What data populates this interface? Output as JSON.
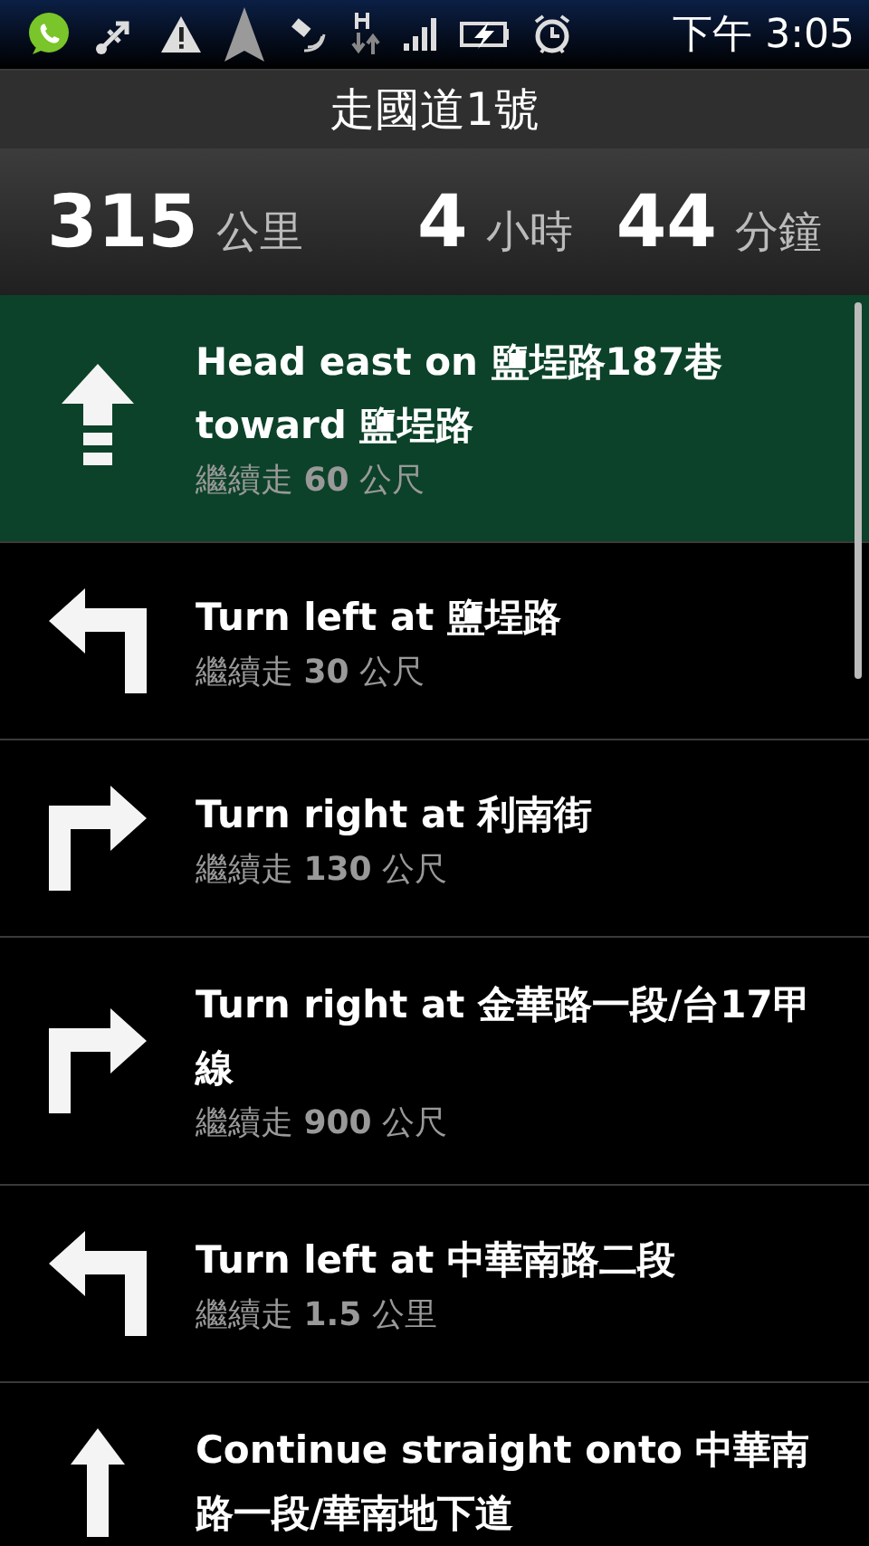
{
  "status_bar": {
    "time": "下午 3:05"
  },
  "header": {
    "title": "走國道1號"
  },
  "summary": {
    "distance": "315",
    "distance_unit": "公里",
    "hours": "4",
    "hours_unit": "小時",
    "minutes": "44",
    "minutes_unit": "分鐘"
  },
  "steps": [
    {
      "kind": "start",
      "instruction": "Head east on 鹽埕路187巷 toward 鹽埕路",
      "distance": "繼續走 **60** 公尺",
      "selected": true
    },
    {
      "kind": "left",
      "instruction": "Turn left at 鹽埕路",
      "distance": "繼續走 **30** 公尺",
      "selected": false
    },
    {
      "kind": "right",
      "instruction": "Turn right at 利南街",
      "distance": "繼續走 **130** 公尺",
      "selected": false
    },
    {
      "kind": "right",
      "instruction": "Turn right at 金華路一段/台17甲線",
      "distance": "繼續走 **900** 公尺",
      "selected": false
    },
    {
      "kind": "left",
      "instruction": "Turn left at 中華南路二段",
      "distance": "繼續走 **1.5** 公里",
      "selected": false
    },
    {
      "kind": "straight",
      "instruction": "Continue straight onto 中華南路一段/華南地下道",
      "selected": false
    }
  ]
}
